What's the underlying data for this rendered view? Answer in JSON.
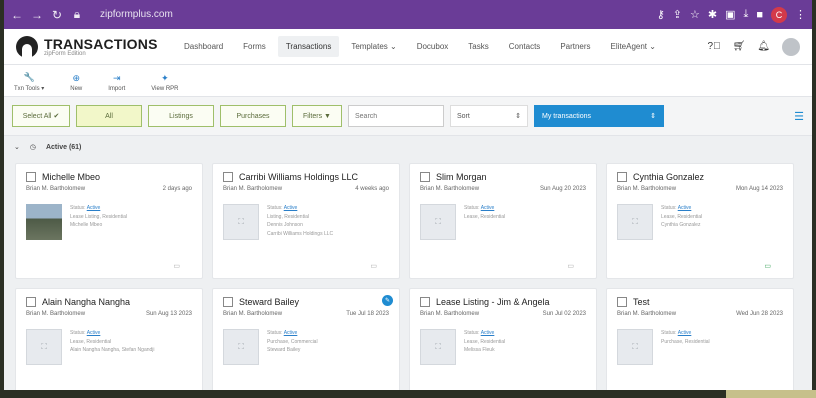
{
  "browser": {
    "url": "zipformplus.com",
    "avatar_letter": "C"
  },
  "app": {
    "logo_title": "TRANSACTIONS",
    "logo_sub": "zipForm Edition"
  },
  "nav": {
    "items": [
      "Dashboard",
      "Forms",
      "Transactions",
      "Templates ⌄",
      "Docubox",
      "Tasks",
      "Contacts",
      "Partners",
      "EliteAgent ⌄"
    ]
  },
  "toolbar": {
    "items": [
      {
        "label": "Txn Tools ▾",
        "icon": "wrench-icon",
        "glyph": "🔧"
      },
      {
        "label": "New",
        "icon": "plus-icon",
        "glyph": "⊕"
      },
      {
        "label": "Import",
        "icon": "import-icon",
        "glyph": "⇥"
      },
      {
        "label": "View RPR",
        "icon": "rpr-icon",
        "glyph": "✦"
      }
    ]
  },
  "filters": {
    "select_all": "Select All",
    "all": "All",
    "listings": "Listings",
    "purchases": "Purchases",
    "filters": "Filters",
    "search_placeholder": "Search",
    "sort": "Sort",
    "my_transactions": "My transactions"
  },
  "section": {
    "title": "Active (61)"
  },
  "cards": [
    {
      "title": "Michelle Mbeo",
      "agent": "Brian M. Bartholomew",
      "date": "2 days ago",
      "status_label": "Status:",
      "status": "Active",
      "line1": "Lease Listing, Residential",
      "line2": "Michelle Mbeo",
      "line3": "",
      "photo": true
    },
    {
      "title": "Carribi Williams Holdings LLC",
      "agent": "Brian M. Bartholomew",
      "date": "4 weeks ago",
      "status_label": "Status:",
      "status": "Active",
      "line1": "Listing, Residential",
      "line2": "Dennis Johnson",
      "line3": "Carribi Williams Holdings LLC",
      "photo": false
    },
    {
      "title": "Slim Morgan",
      "agent": "Brian M. Bartholomew",
      "date": "Sun Aug 20 2023",
      "status_label": "Status:",
      "status": "Active",
      "line1": "Lease, Residential",
      "line2": "",
      "line3": "",
      "photo": false
    },
    {
      "title": "Cynthia Gonzalez",
      "agent": "Brian M. Bartholomew",
      "date": "Mon Aug 14 2023",
      "status_label": "Status:",
      "status": "Active",
      "line1": "Lease, Residential",
      "line2": "Cynthia Gonzalez",
      "line3": "",
      "photo": false
    },
    {
      "title": "Alain Nangha Nangha",
      "agent": "Brian M. Bartholomew",
      "date": "Sun Aug 13 2023",
      "status_label": "Status:",
      "status": "Active",
      "line1": "Lease, Residential",
      "line2": "Alain Nangha Nangha, Stefan Ngandji",
      "line3": "",
      "photo": false
    },
    {
      "title": "Steward Bailey",
      "agent": "Brian M. Bartholomew",
      "date": "Tue Jul 18 2023",
      "status_label": "Status:",
      "status": "Active",
      "line1": "Purchase, Commercial",
      "line2": "Steward Bailey",
      "line3": "",
      "photo": false
    },
    {
      "title": "Lease Listing - Jim & Angela",
      "agent": "Brian M. Bartholomew",
      "date": "Sun Jul 02 2023",
      "status_label": "Status:",
      "status": "Active",
      "line1": "Lease, Residential",
      "line2": "Melissa Fleuk",
      "line3": "",
      "photo": false
    },
    {
      "title": "Test",
      "agent": "Brian M. Bartholomew",
      "date": "Wed Jun 28 2023",
      "status_label": "Status:",
      "status": "Active",
      "line1": "Purchase, Residential",
      "line2": "",
      "line3": "",
      "photo": false
    }
  ],
  "colors": {
    "browser_bar": "#6a3c97",
    "accent": "#1f8cd1",
    "filter_green": "#9fbf6a"
  }
}
